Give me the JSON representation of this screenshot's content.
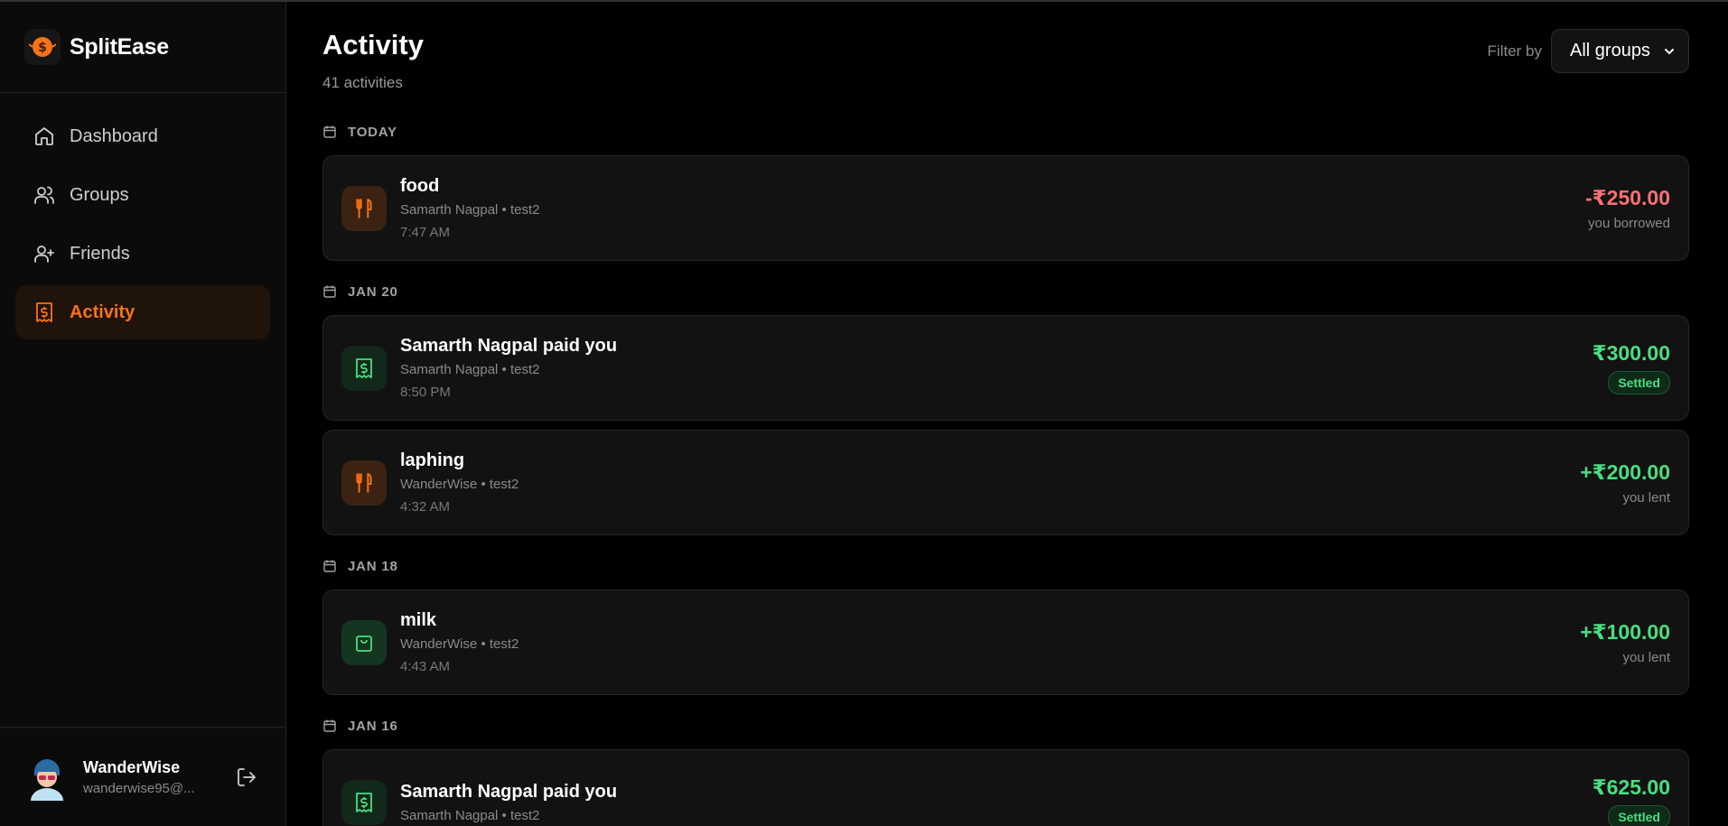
{
  "app": {
    "name": "SplitEase"
  },
  "sidebar": {
    "items": [
      {
        "label": "Dashboard",
        "icon": "home-icon",
        "active": false
      },
      {
        "label": "Groups",
        "icon": "users-icon",
        "active": false
      },
      {
        "label": "Friends",
        "icon": "user-plus-icon",
        "active": false
      },
      {
        "label": "Activity",
        "icon": "receipt-icon",
        "active": true
      }
    ]
  },
  "user": {
    "name": "WanderWise",
    "email": "wanderwise95@..."
  },
  "header": {
    "title": "Activity",
    "count": "41 activities",
    "filter_label": "Filter by",
    "filter_value": "All groups"
  },
  "colors": {
    "accent": "#f97316",
    "positive": "#4ade80",
    "negative": "#f87171",
    "background": "#000000"
  },
  "sections": [
    {
      "date": "TODAY",
      "items": [
        {
          "icon": "fork-knife-icon",
          "title": "food",
          "meta": "Samarth Nagpal • test2",
          "time": "7:47 AM",
          "amount": "-₹250.00",
          "note": "you borrowed"
        }
      ]
    },
    {
      "date": "JAN 20",
      "items": [
        {
          "icon": "receipt-icon",
          "title": "Samarth Nagpal paid you",
          "meta": "Samarth Nagpal • test2",
          "time": "8:50 PM",
          "amount": "₹300.00",
          "badge": "Settled"
        },
        {
          "icon": "fork-knife-icon",
          "title": "laphing",
          "meta": "WanderWise • test2",
          "time": "4:32 AM",
          "amount": "+₹200.00",
          "note": "you lent"
        }
      ]
    },
    {
      "date": "JAN 18",
      "items": [
        {
          "icon": "shopping-bag-icon",
          "title": "milk",
          "meta": "WanderWise • test2",
          "time": "4:43 AM",
          "amount": "+₹100.00",
          "note": "you lent"
        }
      ]
    },
    {
      "date": "JAN 16",
      "items": [
        {
          "icon": "receipt-icon",
          "title": "Samarth Nagpal paid you",
          "meta": "Samarth Nagpal • test2",
          "time": "",
          "amount": "₹625.00",
          "badge": "Settled"
        }
      ]
    }
  ]
}
